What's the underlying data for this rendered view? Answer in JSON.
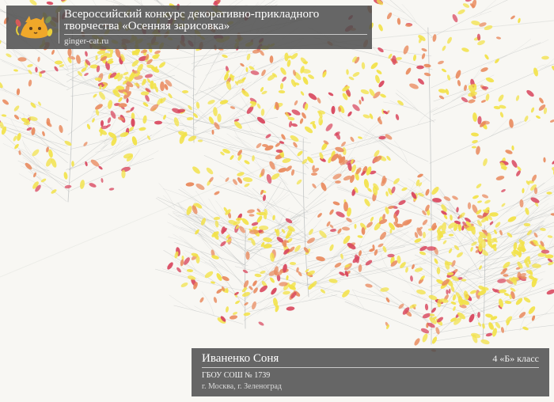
{
  "header": {
    "contest_title": "Всероссийский конкурс декоративно-прикладного творчества «Осенняя зарисовка»",
    "site_name": "ginger-cat.ru"
  },
  "footer": {
    "author_name": "Иваненко Соня",
    "class_label": "4 «Б» класс",
    "school_name": "ГБОУ СОШ № 1739",
    "school_location": "г. Москва, г. Зеленоград"
  },
  "artwork": {
    "subject": "autumn trees",
    "palette": [
      "#f2e24a",
      "#d9485f",
      "#e98b5f",
      "#9aa3a5",
      "#f8f7f3"
    ]
  },
  "logo": {
    "icon": "cat-icon",
    "colors": [
      "#f0a82a",
      "#e9cf3a",
      "#d65a59",
      "#7d8f52"
    ]
  }
}
